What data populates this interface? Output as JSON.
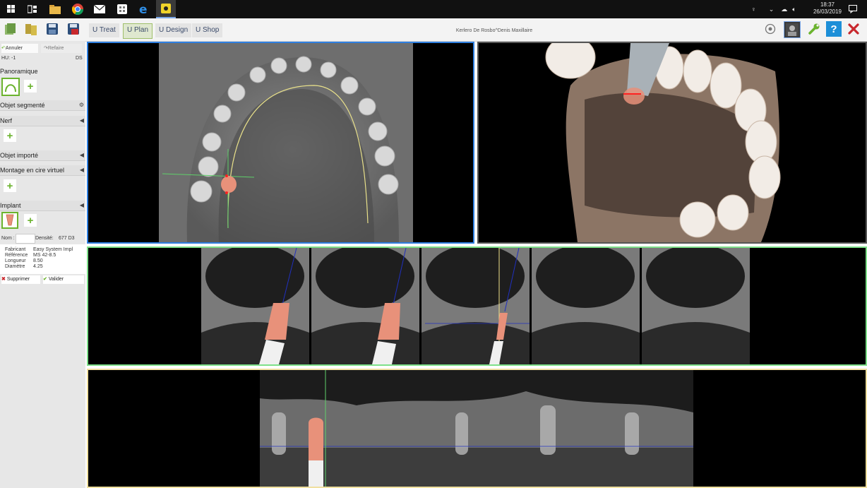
{
  "taskbar": {
    "icons": [
      "windows-logo-icon",
      "task-view-icon",
      "file-explorer-icon",
      "chrome-icon",
      "mail-icon",
      "store-icon",
      "edge-icon",
      "app-icon"
    ],
    "clock_time": "18:37",
    "clock_date": "26/03/2019"
  },
  "toolbar": {
    "tabs": [
      "U Treat",
      "U Plan",
      "U Design",
      "U Shop"
    ],
    "active_tab": "U Plan",
    "title": "Kerlero De Rosbo^Denis Maxillaire"
  },
  "sidebar": {
    "undo": "Annuler",
    "redo": "Refaire",
    "hu": "HU: -1",
    "ds": "DS",
    "sections": {
      "panoramique": "Panoramique",
      "objet_segmente": "Objet segmenté",
      "nerf": "Nerf",
      "objet_importe": "Objet importé",
      "montage": "Montage en cire virtuel",
      "implant": "Implant"
    },
    "implant": {
      "nom_label": "Nom :",
      "densite_label": "Densité:",
      "densite_value": "677 D3",
      "fields": [
        {
          "label": "Fabricant",
          "value": "Easy System Impl"
        },
        {
          "label": "Référence",
          "value": "MS 42-8.5"
        },
        {
          "label": "Longueur",
          "value": "8.50"
        },
        {
          "label": "Diamètre",
          "value": "4.25"
        }
      ],
      "delete": "Supprimer",
      "validate": "Valider"
    }
  },
  "colors": {
    "axial_border": "#2f7fe0",
    "cross_border": "#7ee08a",
    "pano_border": "#f0e0a0",
    "implant": "#e8917a",
    "accent_green": "#6bb32e"
  }
}
